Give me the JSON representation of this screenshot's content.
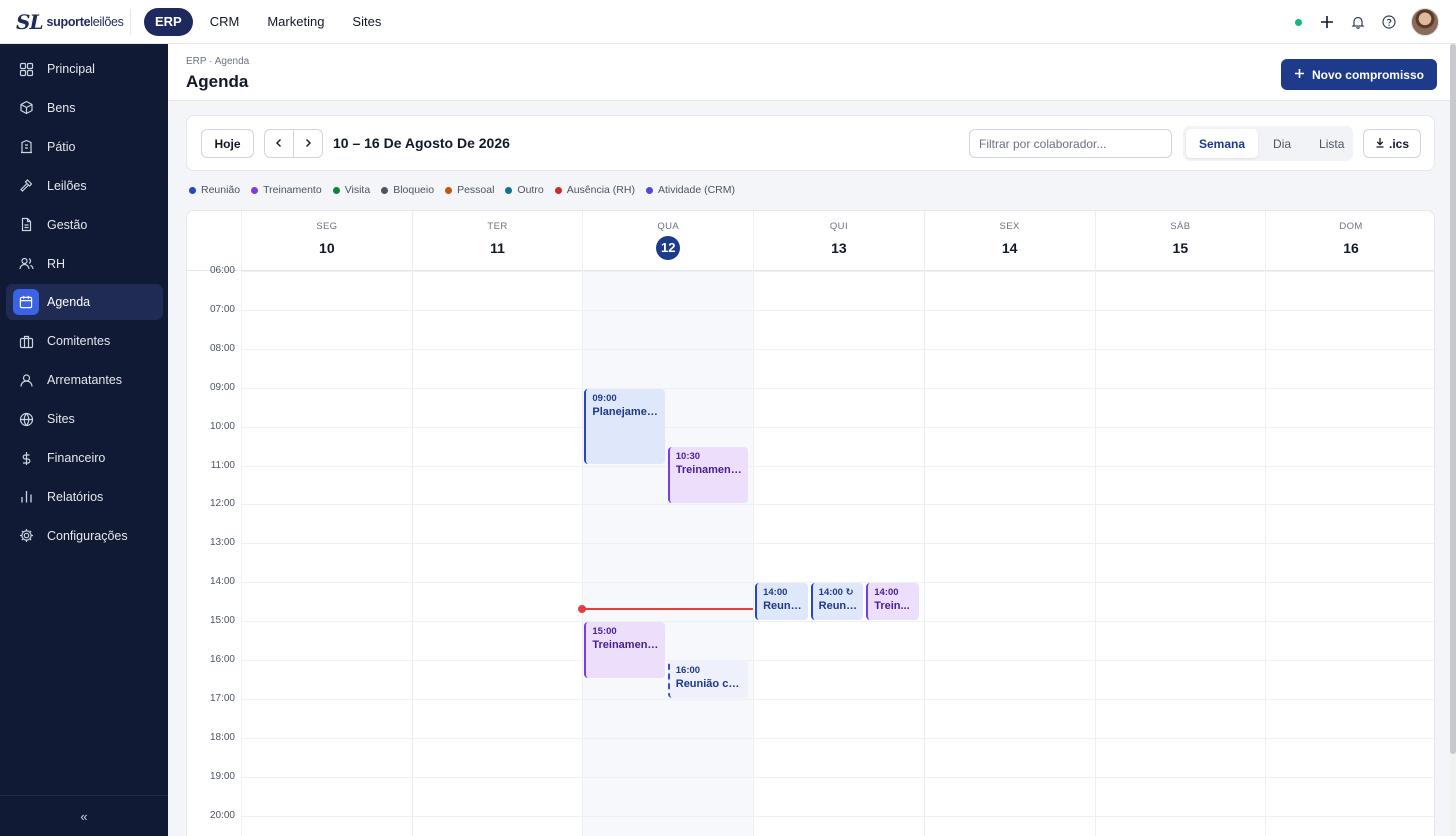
{
  "brand": {
    "mark": "SL",
    "name_bold": "suporte",
    "name_rest": "leilões"
  },
  "topnav": [
    {
      "label": "ERP",
      "active": true
    },
    {
      "label": "CRM",
      "active": false
    },
    {
      "label": "Marketing",
      "active": false
    },
    {
      "label": "Sites",
      "active": false
    }
  ],
  "sidebar": {
    "items": [
      {
        "label": "Principal",
        "icon": "grid-icon"
      },
      {
        "label": "Bens",
        "icon": "box-icon"
      },
      {
        "label": "Pátio",
        "icon": "building-icon"
      },
      {
        "label": "Leilões",
        "icon": "gavel-icon"
      },
      {
        "label": "Gestão",
        "icon": "document-icon"
      },
      {
        "label": "RH",
        "icon": "users-icon"
      },
      {
        "label": "Agenda",
        "icon": "calendar-icon",
        "active": true
      },
      {
        "label": "Comitentes",
        "icon": "briefcase-icon"
      },
      {
        "label": "Arrematantes",
        "icon": "user-icon"
      },
      {
        "label": "Sites",
        "icon": "globe-icon"
      },
      {
        "label": "Financeiro",
        "icon": "dollar-icon"
      },
      {
        "label": "Relatórios",
        "icon": "bar-chart-icon"
      },
      {
        "label": "Configurações",
        "icon": "gear-icon"
      }
    ],
    "collapse_label": "«"
  },
  "header": {
    "breadcrumb": "ERP · Agenda",
    "title": "Agenda",
    "new_button": "Novo compromisso"
  },
  "toolbar": {
    "today": "Hoje",
    "range": "10 – 16 De Agosto De 2026",
    "filter_placeholder": "Filtrar por colaborador...",
    "views": [
      {
        "label": "Semana",
        "active": true
      },
      {
        "label": "Dia",
        "active": false
      },
      {
        "label": "Lista",
        "active": false
      }
    ],
    "export": ".ics"
  },
  "legend": [
    {
      "label": "Reunião",
      "color": "#2447c5"
    },
    {
      "label": "Treinamento",
      "color": "#7c3aed"
    },
    {
      "label": "Visita",
      "color": "#15803d"
    },
    {
      "label": "Bloqueio",
      "color": "#4b5563"
    },
    {
      "label": "Pessoal",
      "color": "#c2570c"
    },
    {
      "label": "Outro",
      "color": "#0e7490"
    },
    {
      "label": "Ausência (RH)",
      "color": "#dc2626"
    },
    {
      "label": "Atividade (CRM)",
      "color": "#4f46e5"
    }
  ],
  "days": [
    {
      "weekday": "SEG",
      "num": "10"
    },
    {
      "weekday": "TER",
      "num": "11"
    },
    {
      "weekday": "QUA",
      "num": "12",
      "today": true
    },
    {
      "weekday": "QUI",
      "num": "13"
    },
    {
      "weekday": "SEX",
      "num": "14"
    },
    {
      "weekday": "SÁB",
      "num": "15"
    },
    {
      "weekday": "DOM",
      "num": "16"
    }
  ],
  "hours": [
    "06:00",
    "07:00",
    "08:00",
    "09:00",
    "10:00",
    "11:00",
    "12:00",
    "13:00",
    "14:00",
    "15:00",
    "16:00",
    "17:00",
    "18:00",
    "19:00",
    "20:00"
  ],
  "now": {
    "day": 2,
    "hour": 14.7
  },
  "events": [
    {
      "day": 2,
      "start": 9,
      "end": 11,
      "lane": 0,
      "lanes": 2,
      "time": "09:00",
      "title": "Planejamen...",
      "kind": "blue"
    },
    {
      "day": 2,
      "start": 10.5,
      "end": 12,
      "lane": 1,
      "lanes": 2,
      "time": "10:30",
      "title": "Treinament...",
      "kind": "purple"
    },
    {
      "day": 3,
      "start": 14,
      "end": 15,
      "lane": 0,
      "lanes": 3,
      "time": "14:00",
      "title": "Reuni...",
      "kind": "blue"
    },
    {
      "day": 3,
      "start": 14,
      "end": 15,
      "lane": 1,
      "lanes": 3,
      "time": "14:00 ↻",
      "title": "Reuni...",
      "kind": "blue"
    },
    {
      "day": 3,
      "start": 14,
      "end": 15,
      "lane": 2,
      "lanes": 3,
      "time": "14:00",
      "title": "Trein...",
      "kind": "purple"
    },
    {
      "day": 2,
      "start": 15,
      "end": 16.5,
      "lane": 0,
      "lanes": 2,
      "time": "15:00",
      "title": "Treinament...",
      "kind": "purple"
    },
    {
      "day": 2,
      "start": 16,
      "end": 17,
      "lane": 1,
      "lanes": 2,
      "time": "16:00",
      "title": "Reunião co...",
      "kind": "dashed"
    }
  ]
}
